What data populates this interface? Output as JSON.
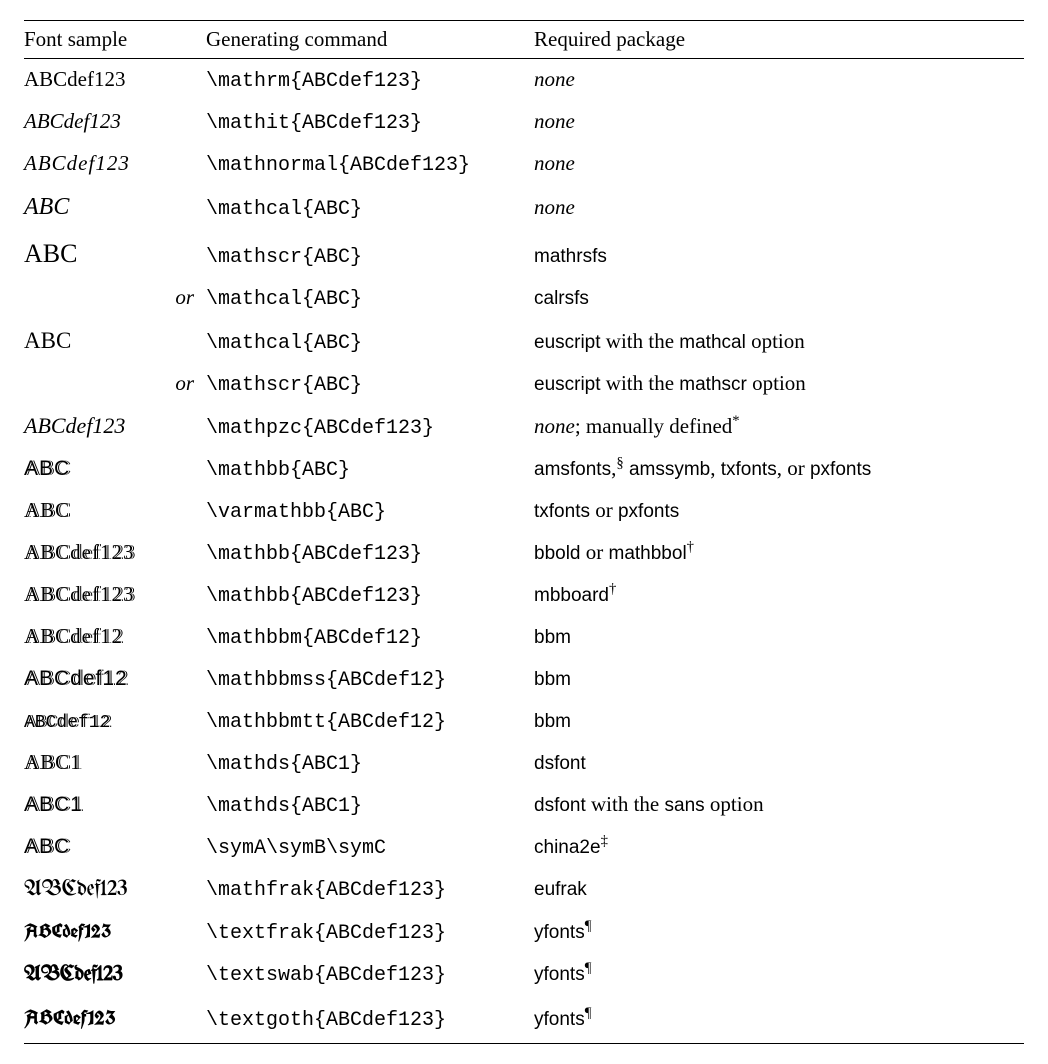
{
  "headers": {
    "sample": "Font sample",
    "command": "Generating command",
    "package": "Required package"
  },
  "or_label": "or",
  "none_label": "none",
  "rows": [
    {
      "sample": "ABCdef123",
      "sample_class": "samp-rm",
      "command": "\\mathrm{ABCdef123}",
      "pkg_kind": "none"
    },
    {
      "sample": "ABCdef123",
      "sample_class": "samp-it",
      "command": "\\mathit{ABCdef123}",
      "pkg_kind": "none"
    },
    {
      "sample": "ABCdef123",
      "sample_class": "samp-norm",
      "command": "\\mathnormal{ABCdef123}",
      "pkg_kind": "none"
    },
    {
      "sample": "ABC",
      "sample_class": "samp-cal",
      "command": "\\mathcal{ABC}",
      "pkg_kind": "none"
    },
    {
      "sample": "ABC",
      "sample_class": "samp-scr",
      "command": "\\mathscr{ABC}",
      "pkg_kind": "sf",
      "pkg": [
        "mathrsfs"
      ]
    },
    {
      "is_or": true,
      "command": "\\mathcal{ABC}",
      "pkg_kind": "sf",
      "pkg": [
        "calrsfs"
      ]
    },
    {
      "sample": "ABC",
      "sample_class": "samp-eu",
      "command": "\\mathcal{ABC}",
      "pkg_kind": "mixed",
      "parts": [
        {
          "t": "euscript",
          "c": "sf"
        },
        {
          "t": " with the ",
          "c": ""
        },
        {
          "t": "mathcal",
          "c": "sf"
        },
        {
          "t": " option",
          "c": ""
        }
      ]
    },
    {
      "is_or": true,
      "command": "\\mathscr{ABC}",
      "pkg_kind": "mixed",
      "parts": [
        {
          "t": "euscript",
          "c": "sf"
        },
        {
          "t": " with the ",
          "c": ""
        },
        {
          "t": "mathscr",
          "c": "sf"
        },
        {
          "t": " option",
          "c": ""
        }
      ]
    },
    {
      "sample": "ABCdef123",
      "sample_class": "samp-pzc",
      "command": "\\mathpzc{ABCdef123}",
      "pkg_kind": "mixed",
      "parts": [
        {
          "t": "none",
          "c": "it"
        },
        {
          "t": "; manually defined",
          "c": ""
        },
        {
          "t": "*",
          "c": "sup"
        }
      ]
    },
    {
      "sample": "ABC",
      "sample_class": "samp-bb",
      "command": "\\mathbb{ABC}",
      "pkg_kind": "mixed",
      "parts": [
        {
          "t": "amsfonts",
          "c": "sf"
        },
        {
          "t": ",",
          "c": ""
        },
        {
          "t": "§",
          "c": "sup"
        },
        {
          "t": " ",
          "c": ""
        },
        {
          "t": "amssymb",
          "c": "sf"
        },
        {
          "t": ", ",
          "c": ""
        },
        {
          "t": "txfonts",
          "c": "sf"
        },
        {
          "t": ", or ",
          "c": ""
        },
        {
          "t": "pxfonts",
          "c": "sf"
        }
      ]
    },
    {
      "sample": "ABC",
      "sample_class": "samp-bb2",
      "command": "\\varmathbb{ABC}",
      "pkg_kind": "mixed",
      "parts": [
        {
          "t": "txfonts",
          "c": "sf"
        },
        {
          "t": " or ",
          "c": ""
        },
        {
          "t": "pxfonts",
          "c": "sf"
        }
      ]
    },
    {
      "sample": "ABCdef123",
      "sample_class": "samp-bbm",
      "command": "\\mathbb{ABCdef123}",
      "pkg_kind": "mixed",
      "parts": [
        {
          "t": "bbold",
          "c": "sf"
        },
        {
          "t": " or ",
          "c": ""
        },
        {
          "t": "mathbbol",
          "c": "sf"
        },
        {
          "t": "†",
          "c": "sup"
        }
      ]
    },
    {
      "sample": "ABCdef123",
      "sample_class": "samp-bbm",
      "command": "\\mathbb{ABCdef123}",
      "pkg_kind": "mixed",
      "parts": [
        {
          "t": "mbboard",
          "c": "sf"
        },
        {
          "t": "†",
          "c": "sup"
        }
      ]
    },
    {
      "sample": "ABCdef12",
      "sample_class": "samp-bbm",
      "command": "\\mathbbm{ABCdef12}",
      "pkg_kind": "sf",
      "pkg": [
        "bbm"
      ]
    },
    {
      "sample": "ABCdef12",
      "sample_class": "samp-bbmss",
      "command": "\\mathbbmss{ABCdef12}",
      "pkg_kind": "sf",
      "pkg": [
        "bbm"
      ]
    },
    {
      "sample": "ABCdef12",
      "sample_class": "samp-bbmtt",
      "command": "\\mathbbmtt{ABCdef12}",
      "pkg_kind": "sf",
      "pkg": [
        "bbm"
      ]
    },
    {
      "sample": "ABC1",
      "sample_class": "samp-ds",
      "command": "\\mathds{ABC1}",
      "pkg_kind": "sf",
      "pkg": [
        "dsfont"
      ]
    },
    {
      "sample": "ABC1",
      "sample_class": "samp-dssf",
      "command": "\\mathds{ABC1}",
      "pkg_kind": "mixed",
      "parts": [
        {
          "t": "dsfont",
          "c": "sf"
        },
        {
          "t": " with the ",
          "c": ""
        },
        {
          "t": "sans",
          "c": "sf"
        },
        {
          "t": " option",
          "c": ""
        }
      ]
    },
    {
      "sample": "ABC",
      "sample_class": "samp-china",
      "command": "\\symA\\symB\\symC",
      "pkg_kind": "mixed",
      "parts": [
        {
          "t": "china2e",
          "c": "sf"
        },
        {
          "t": "‡",
          "c": "sup"
        }
      ]
    },
    {
      "sample": "ABCdef123",
      "sample_class": "samp-frak",
      "command": "\\mathfrak{ABCdef123}",
      "pkg_kind": "sf",
      "pkg": [
        "eufrak"
      ]
    },
    {
      "sample": "ABCdef123",
      "sample_class": "samp-frak2",
      "command": "\\textfrak{ABCdef123}",
      "pkg_kind": "mixed",
      "parts": [
        {
          "t": "yfonts",
          "c": "sf"
        },
        {
          "t": "¶",
          "c": "sup"
        }
      ]
    },
    {
      "sample": "ABCdef123",
      "sample_class": "samp-swab",
      "command": "\\textswab{ABCdef123}",
      "pkg_kind": "mixed",
      "parts": [
        {
          "t": "yfonts",
          "c": "sf"
        },
        {
          "t": "¶",
          "c": "sup"
        }
      ]
    },
    {
      "sample": "ABCdef123",
      "sample_class": "samp-goth",
      "command": "\\textgoth{ABCdef123}",
      "pkg_kind": "mixed",
      "parts": [
        {
          "t": "yfonts",
          "c": "sf"
        },
        {
          "t": "¶",
          "c": "sup"
        }
      ]
    }
  ]
}
